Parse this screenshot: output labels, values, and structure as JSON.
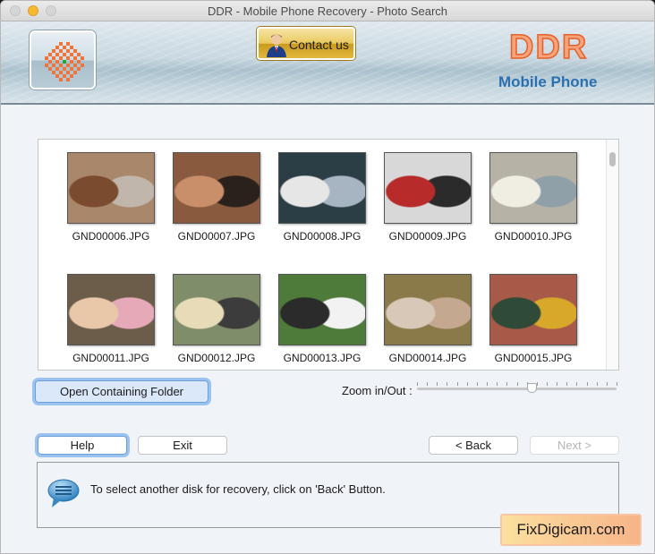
{
  "window": {
    "title": "DDR - Mobile Phone Recovery - Photo Search"
  },
  "banner": {
    "contact_label": "Contact us",
    "brand_name": "DDR",
    "brand_sub": "Mobile Phone",
    "brand_color": "#e5602a",
    "sub_color": "#2a70b0"
  },
  "gallery": {
    "items": [
      {
        "name": "GND00006.JPG",
        "colors": [
          "#a9876a",
          "#7a4b2e",
          "#c0b6ac"
        ]
      },
      {
        "name": "GND00007.JPG",
        "colors": [
          "#8a5a3f",
          "#c98f6a",
          "#2a211d"
        ]
      },
      {
        "name": "GND00008.JPG",
        "colors": [
          "#2c3e45",
          "#e6e6e6",
          "#a7b4c2"
        ]
      },
      {
        "name": "GND00009.JPG",
        "colors": [
          "#d8d8d8",
          "#b82b2b",
          "#2b2b2b"
        ]
      },
      {
        "name": "GND00010.JPG",
        "colors": [
          "#b7b2a6",
          "#f0ede2",
          "#8fa0a8"
        ]
      },
      {
        "name": "GND00011.JPG",
        "colors": [
          "#6c5c4a",
          "#e8c8a8",
          "#e5a9b8"
        ]
      },
      {
        "name": "GND00012.JPG",
        "colors": [
          "#7f8d6a",
          "#e8dcb8",
          "#3c3c3c"
        ]
      },
      {
        "name": "GND00013.JPG",
        "colors": [
          "#4e7a3a",
          "#2b2b2b",
          "#f2f2f2"
        ]
      },
      {
        "name": "GND00014.JPG",
        "colors": [
          "#8a7a4a",
          "#d8c8b8",
          "#c4a890"
        ]
      },
      {
        "name": "GND00015.JPG",
        "colors": [
          "#a85a48",
          "#2f4a36",
          "#d8a82a"
        ]
      }
    ]
  },
  "controls": {
    "open_folder_label": "Open Containing Folder",
    "zoom_label": "Zoom in/Out :",
    "zoom_value": 0.5,
    "zoom_ticks": 21
  },
  "nav": {
    "help_label": "Help",
    "exit_label": "Exit",
    "back_label": "< Back",
    "next_label": "Next >"
  },
  "message": {
    "text": "To select another disk for recovery, click on 'Back' Button."
  },
  "watermark": {
    "text": "FixDigicam.com"
  }
}
